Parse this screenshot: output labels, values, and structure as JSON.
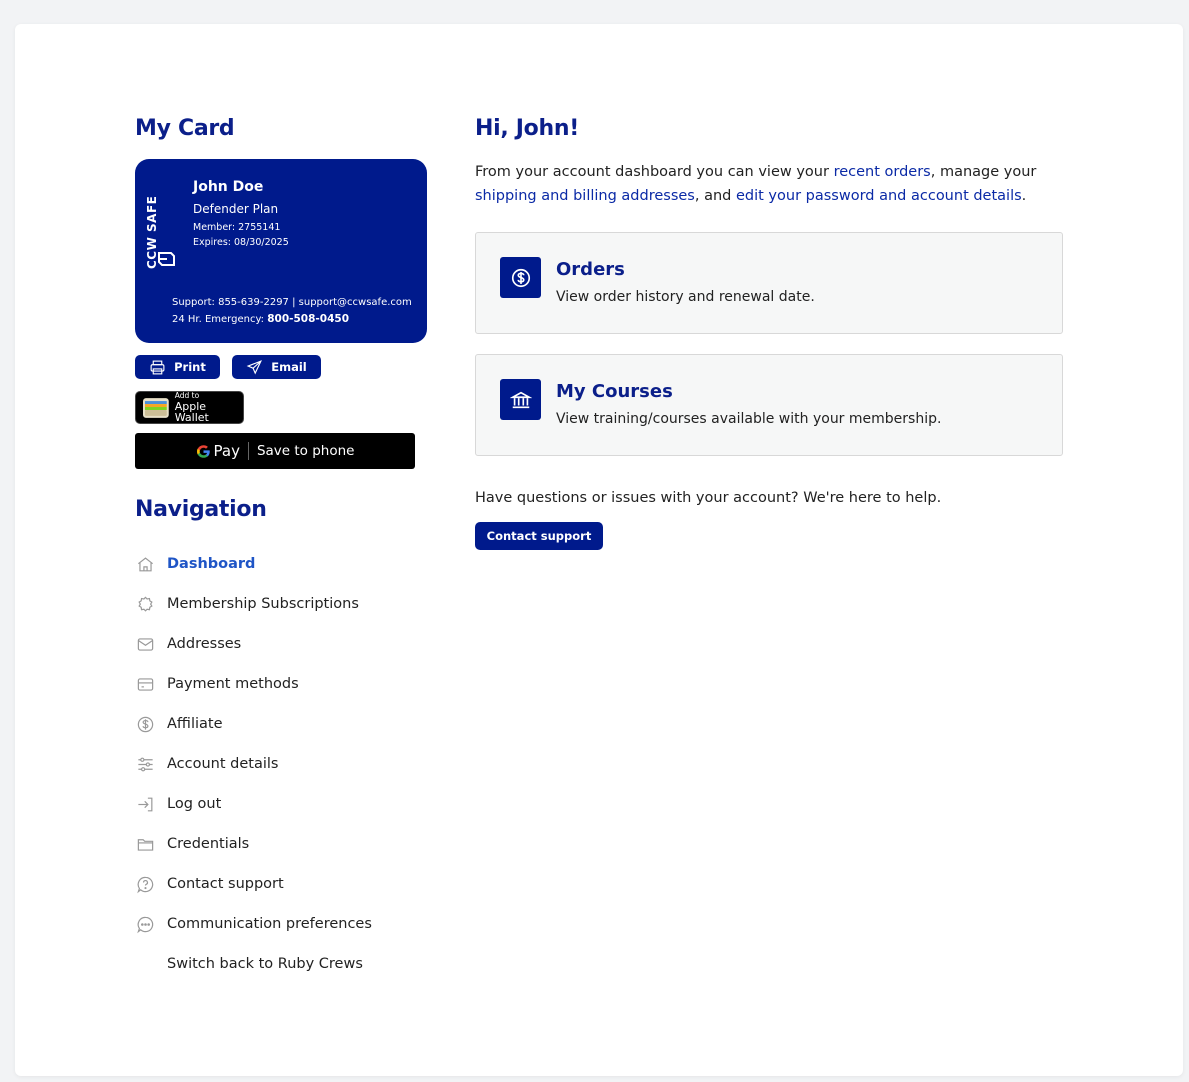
{
  "card_section": {
    "title": "My Card",
    "card": {
      "brand": "CCW SAFE",
      "name": "John Doe",
      "plan": "Defender Plan",
      "member": "Member: 2755141",
      "expires": "Expires: 08/30/2025",
      "support": "Support: 855-639-2297 | support@ccwsafe.com",
      "emergency_label": "24 Hr. Emergency:",
      "emergency_number": "800-508-0450",
      "color": "#001a8c"
    },
    "print_label": "Print",
    "email_label": "Email",
    "wallet_small": "Add to",
    "wallet_big": "Apple Wallet",
    "gpay_word": "Pay",
    "gpay_save": "Save to phone"
  },
  "navigation": {
    "title": "Navigation",
    "items": [
      {
        "label": "Dashboard",
        "icon": "home-icon",
        "active": true
      },
      {
        "label": "Membership Subscriptions",
        "icon": "badge-icon"
      },
      {
        "label": "Addresses",
        "icon": "envelope-icon"
      },
      {
        "label": "Payment methods",
        "icon": "credit-card-icon"
      },
      {
        "label": "Affiliate",
        "icon": "dollar-circle-icon"
      },
      {
        "label": "Account details",
        "icon": "sliders-icon"
      },
      {
        "label": "Log out",
        "icon": "login-arrow-icon"
      },
      {
        "label": "Credentials",
        "icon": "folder-icon"
      },
      {
        "label": "Contact support",
        "icon": "question-bubble-icon"
      },
      {
        "label": "Communication preferences",
        "icon": "chat-bubble-icon"
      },
      {
        "label": "Switch back to Ruby Crews",
        "icon": ""
      }
    ]
  },
  "main": {
    "greeting": "Hi, John!",
    "intro": {
      "t1": "From your account dashboard you can view your ",
      "l1": "recent orders",
      "t2": ", manage your ",
      "l2": "shipping and billing addresses",
      "t3": ", and ",
      "l3": "edit your password and account details",
      "t4": "."
    },
    "tiles": [
      {
        "title": "Orders",
        "desc": "View order history and renewal date.",
        "icon": "dollar-circle-icon"
      },
      {
        "title": "My Courses",
        "desc": "View training/courses available with your membership.",
        "icon": "bank-icon"
      }
    ],
    "help_text": "Have questions or issues with your account? We're here to help.",
    "contact_label": "Contact support"
  },
  "colors": {
    "brand_navy": "#001a8c",
    "link_blue": "#1f55c6",
    "heading_navy": "#0b1f8a"
  }
}
